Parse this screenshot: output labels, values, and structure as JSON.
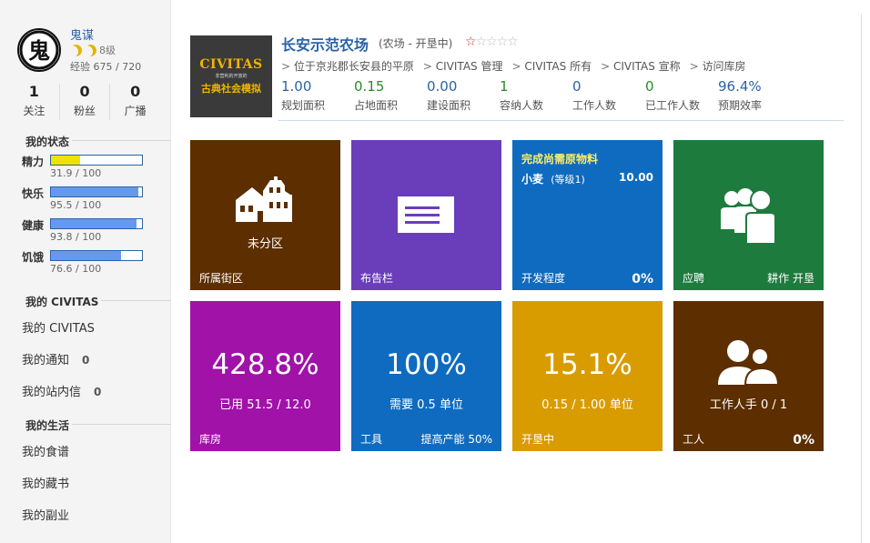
{
  "user": {
    "name": "鬼谋",
    "level": "8级",
    "exp": "经验 675 / 720",
    "avatar_text": "鬼"
  },
  "counts": [
    {
      "value": "1",
      "label": "关注"
    },
    {
      "value": "0",
      "label": "粉丝"
    },
    {
      "value": "0",
      "label": "广播"
    }
  ],
  "status": {
    "title": "我的状态",
    "items": [
      {
        "label": "精力",
        "text": "31.9 / 100",
        "value": 31.9,
        "color": "#f2e000"
      },
      {
        "label": "快乐",
        "text": "95.5 / 100",
        "value": 95.5,
        "color": "#6699ee"
      },
      {
        "label": "健康",
        "text": "93.8 / 100",
        "value": 93.8,
        "color": "#6699ee"
      },
      {
        "label": "饥饿",
        "text": "76.6 / 100",
        "value": 76.6,
        "color": "#6699ee"
      }
    ]
  },
  "civitas": {
    "title": "我的 CIVITAS",
    "items": [
      {
        "label": "我的 CIVITAS",
        "count": ""
      },
      {
        "label": "我的通知",
        "count": "0"
      },
      {
        "label": "我的站内信",
        "count": "0"
      }
    ]
  },
  "life": {
    "title": "我的生活",
    "items": [
      {
        "label": "我的食谱"
      },
      {
        "label": "我的藏书"
      },
      {
        "label": "我的副业"
      }
    ]
  },
  "farm": {
    "logo_title": "CIVITAS",
    "logo_tiny": "非营利的开放的",
    "logo_cn": "古典社会模拟",
    "title": "长安示范农场",
    "subtitle": "(农场 - 开垦中)",
    "rating": 1,
    "breadcrumbs": [
      "位于京兆郡长安县的平原",
      "CIVITAS 管理",
      "CIVITAS 所有",
      "CIVITAS 宣称",
      "访问库房"
    ],
    "metrics": [
      {
        "value": "1.00",
        "label": "规划面积",
        "color": "#2a63a8"
      },
      {
        "value": "0.15",
        "label": "占地面积",
        "color": "#2a8a2a"
      },
      {
        "value": "0.00",
        "label": "建设面积",
        "color": "#2a63a8"
      },
      {
        "value": "1",
        "label": "容纳人数",
        "color": "#2a8a2a"
      },
      {
        "value": "0",
        "label": "工作人数",
        "color": "#2a63a8"
      },
      {
        "value": "0",
        "label": "已工作人数",
        "color": "#2a8a2a"
      },
      {
        "value": "96.4%",
        "label": "预期效率",
        "color": "#2a63a8"
      }
    ]
  },
  "tiles": {
    "district": {
      "center": "未分区",
      "foot": "所属街区",
      "color": "#5c2e00"
    },
    "board": {
      "foot": "布告栏",
      "color": "#6a3dba"
    },
    "develop": {
      "title": "完成尚需原物料",
      "item_name": "小麦",
      "item_level": "(等级1)",
      "item_qty": "10.00",
      "foot": "开发程度",
      "pct": "0%",
      "color": "#0f6bbf"
    },
    "recruit": {
      "foot": "应聘",
      "foot_right": "耕作 开垦",
      "color": "#1e7b3e"
    },
    "storage": {
      "big": "428.8%",
      "mid": "已用 51.5 / 12.0",
      "foot": "库房",
      "color": "#a012a8"
    },
    "tools": {
      "big": "100%",
      "mid": "需要 0.5 单位",
      "foot": "工具",
      "foot_right": "提高产能 50%",
      "color": "#0f6bbf"
    },
    "reclaim": {
      "big": "15.1%",
      "mid": "0.15 / 1.00 单位",
      "foot": "开垦中",
      "color": "#d89c00"
    },
    "workers": {
      "mid": "工作人手 0 / 1",
      "foot": "工人",
      "pct": "0%",
      "color": "#5c2e00"
    }
  }
}
